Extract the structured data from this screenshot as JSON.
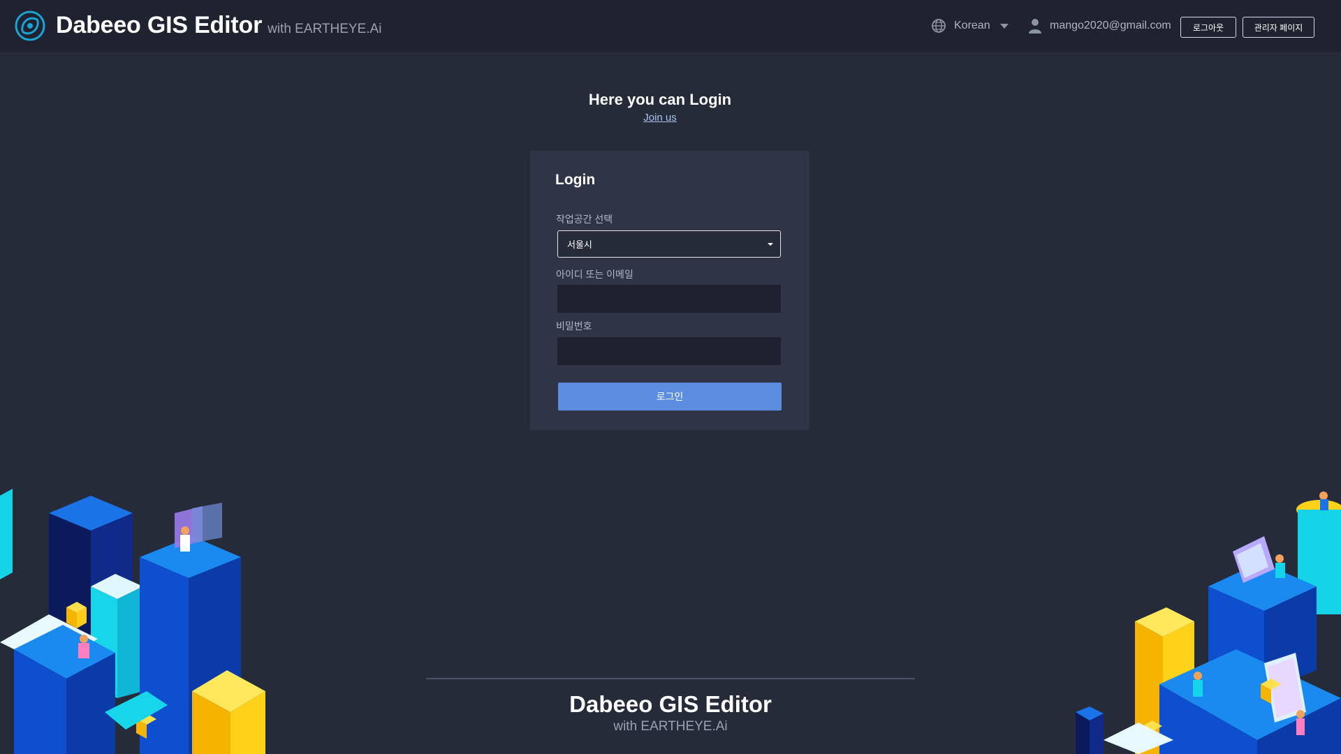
{
  "header": {
    "title": "Dabeeo GIS Editor",
    "subtitle": "with EARTHEYE.Ai",
    "language": "Korean",
    "user_email": "mango2020@gmail.com",
    "logout_label": "로그아웃",
    "admin_label": "관리자 페이지"
  },
  "main": {
    "heading": "Here you can Login",
    "join_link": "Join us"
  },
  "login_form": {
    "title": "Login",
    "workspace_label": "작업공간 선택",
    "workspace_value": "서울시",
    "id_label": "아이디 또는 이메일",
    "id_value": "",
    "password_label": "비밀번호",
    "password_value": "",
    "submit_label": "로그인"
  },
  "footer": {
    "title": "Dabeeo GIS Editor",
    "subtitle": "with EARTHEYE.Ai"
  },
  "colors": {
    "background": "#262b3a",
    "header": "#1f2330",
    "card": "#2f3447",
    "primary_button": "#5b8ee0",
    "link": "#a9c3ee",
    "logo_accent": "#1aa4d6"
  }
}
